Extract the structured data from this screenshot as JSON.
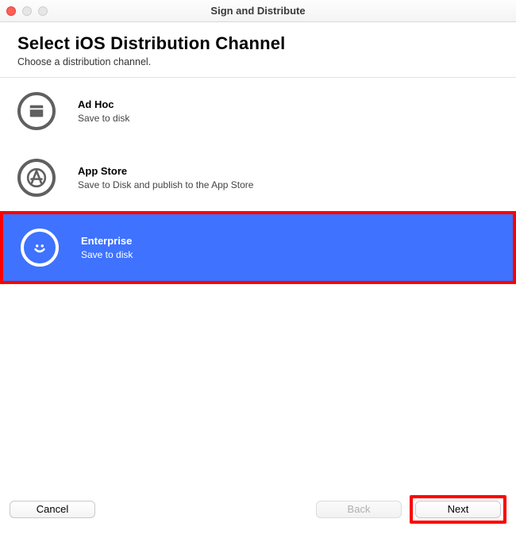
{
  "window": {
    "title": "Sign and Distribute"
  },
  "header": {
    "title": "Select iOS Distribution Channel",
    "subtitle": "Choose a distribution channel."
  },
  "channels": [
    {
      "title": "Ad Hoc",
      "subtitle": "Save to disk",
      "selected": false
    },
    {
      "title": "App Store",
      "subtitle": "Save to Disk and publish to the App Store",
      "selected": false
    },
    {
      "title": "Enterprise",
      "subtitle": "Save to disk",
      "selected": true
    }
  ],
  "footer": {
    "cancel": "Cancel",
    "back": "Back",
    "next": "Next"
  },
  "highlight": {
    "color": "#ff0000"
  }
}
